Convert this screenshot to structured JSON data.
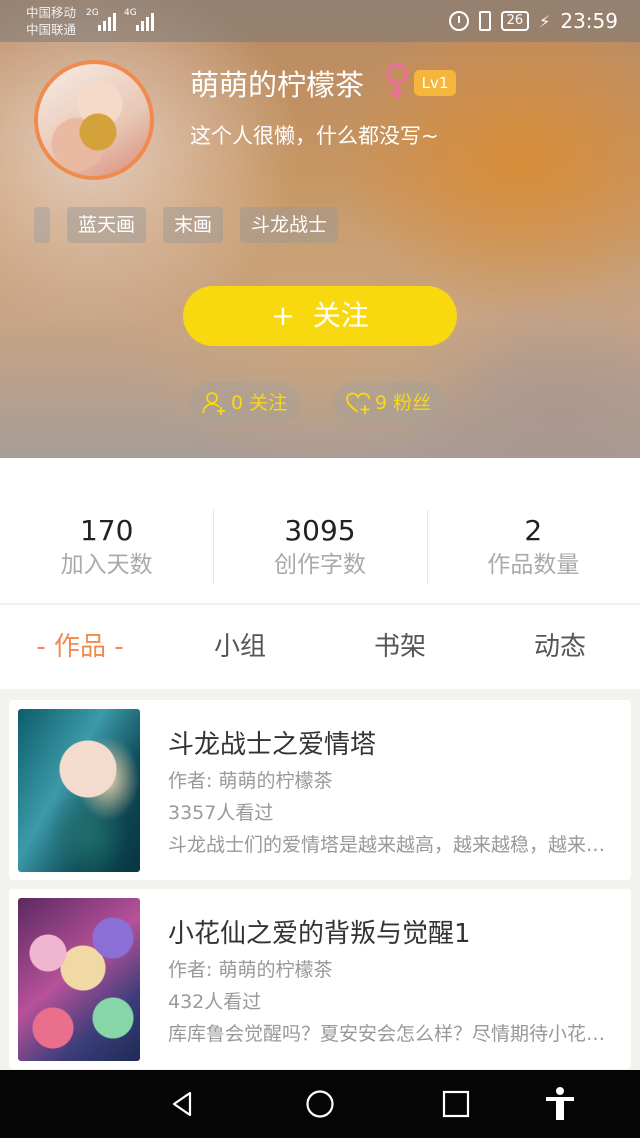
{
  "status_bar": {
    "carrier_1": "中国移动",
    "carrier_2": "中国联通",
    "net_1": "2G",
    "net_2": "4G",
    "battery": "26",
    "time": "23:59"
  },
  "profile": {
    "username": "萌萌的柠檬茶",
    "gender_symbol": "♀",
    "level": "Lv1",
    "bio": "这个人很懒，什么都没写~",
    "tags": [
      "蓝天画",
      "末画",
      "斗龙战士"
    ],
    "follow_label": "关注",
    "follow_icon": "+",
    "following_label": "0 关注",
    "fans_label": "9 粉丝"
  },
  "stats": [
    {
      "value": "170",
      "label": "加入天数"
    },
    {
      "value": "3095",
      "label": "创作字数"
    },
    {
      "value": "2",
      "label": "作品数量"
    }
  ],
  "tabs": [
    {
      "label": "- 作品 -",
      "active": true
    },
    {
      "label": "小组",
      "active": false
    },
    {
      "label": "书架",
      "active": false
    },
    {
      "label": "动态",
      "active": false
    }
  ],
  "works": [
    {
      "title": "斗龙战士之爱情塔",
      "author": "作者: 萌萌的柠檬茶",
      "views": "3357人看过",
      "desc": "斗龙战士们的爱情塔是越来越高，越来越稳，越来越美"
    },
    {
      "title": "小花仙之爱的背叛与觉醒1",
      "author": "作者: 萌萌的柠檬茶",
      "views": "432人看过",
      "desc": "库库鲁会觉醒吗？夏安安会怎么样？尽情期待小花仙之爱"
    }
  ],
  "colors": {
    "accent": "#f08a4e",
    "follow_button": "#f8d90f",
    "level_badge": "#f6b63c"
  },
  "icons": {
    "nav": [
      "back-icon",
      "home-icon",
      "recents-icon",
      "accessibility-icon"
    ],
    "pills": [
      "user-add-icon",
      "heart-plus-icon"
    ]
  }
}
